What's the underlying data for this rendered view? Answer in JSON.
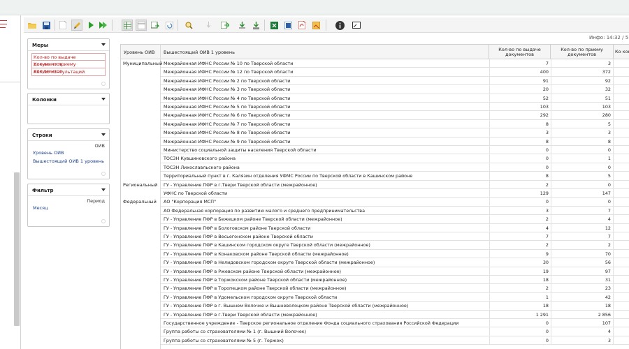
{
  "info": {
    "label": "Инфо:",
    "time": "14:32",
    "rest": "/ 5 :"
  },
  "panels": {
    "measures": {
      "title": "Меры",
      "items": [
        "Кол-во по выдаче документов",
        "Кол-во по приему документов",
        "Кол-во консультаций"
      ]
    },
    "columns": {
      "title": "Колонки"
    },
    "rows": {
      "title": "Строки",
      "sub": "ОИВ",
      "items": [
        "Уровень ОИВ",
        "Вышестоящий ОИВ 1 уровень"
      ]
    },
    "filter": {
      "title": "Фильтр",
      "sub": "Период",
      "items": [
        "Месяц"
      ]
    }
  },
  "table": {
    "headers": {
      "level": "Уровень ОИВ",
      "parent": "Вышестоящий ОИВ 1 уровень",
      "issue": "Кол-во по выдаче документов",
      "accept": "Кол-во по приему документов",
      "cons": "Ко конс"
    },
    "groups": [
      {
        "label": "Муниципальный",
        "startRow": 0
      },
      {
        "label": "Региональный",
        "startRow": 14
      },
      {
        "label": "Федеральный",
        "startRow": 16
      }
    ],
    "rows": [
      {
        "name": "Межрайонная ИФНС России № 10 по Тверской области",
        "issue": "7",
        "accept": "3"
      },
      {
        "name": "Межрайонная ИФНС России № 12 по Тверской области",
        "issue": "400",
        "accept": "372"
      },
      {
        "name": "Межрайонная ИФНС России № 2 по Тверской области",
        "issue": "91",
        "accept": "92"
      },
      {
        "name": "Межрайонная ИФНС России № 3 по Тверской области",
        "issue": "20",
        "accept": "32"
      },
      {
        "name": "Межрайонная ИФНС России № 4 по Тверской области",
        "issue": "52",
        "accept": "51"
      },
      {
        "name": "Межрайонная ИФНС России № 5 по Тверской области",
        "issue": "103",
        "accept": "103"
      },
      {
        "name": "Межрайонная ИФНС России № 6 по Тверской области",
        "issue": "292",
        "accept": "280"
      },
      {
        "name": "Межрайонная ИФНС России № 7 по Тверской области",
        "issue": "8",
        "accept": "5"
      },
      {
        "name": "Межрайонная ИФНС России № 8 по Тверской области",
        "issue": "3",
        "accept": "3"
      },
      {
        "name": "Межрайонная ИФНС России № 9 по Тверской области",
        "issue": "8",
        "accept": "8"
      },
      {
        "name": "Министерство социальной защиты населения Тверской области",
        "issue": "0",
        "accept": "0"
      },
      {
        "name": "ТОСЗН Кувшиновского района",
        "issue": "0",
        "accept": "1"
      },
      {
        "name": "ТОСЗН Лихославльского района",
        "issue": "0",
        "accept": "0"
      },
      {
        "name": "Территориальный пункт в г. Калязин отделения УФМС России по Тверской области в Кашинском районе",
        "issue": "8",
        "accept": "5"
      },
      {
        "name": "ГУ - Управление ПФР в г.Твери Тверской области (межрайонное)",
        "issue": "2",
        "accept": "0"
      },
      {
        "name": "УФНС по Тверской области",
        "issue": "129",
        "accept": "147"
      },
      {
        "name": "АО \"Корпорация МСП\"",
        "issue": "0",
        "accept": "0"
      },
      {
        "name": "АО Федеральная корпорация по развитию малого и среднего предпринимательства",
        "issue": "3",
        "accept": "7"
      },
      {
        "name": "ГУ - Управление ПФР в Бежецком районе Тверской области (межрайонное)",
        "issue": "2",
        "accept": "4"
      },
      {
        "name": "ГУ - Управление ПФР в Бологовском районе Тверской области",
        "issue": "4",
        "accept": "12"
      },
      {
        "name": "ГУ - Управление ПФР в Весьегонском районе Тверской области",
        "issue": "7",
        "accept": "7"
      },
      {
        "name": "ГУ - Управление ПФР в Кашинском городском округе Тверской области (межрайонное)",
        "issue": "2",
        "accept": "2"
      },
      {
        "name": "ГУ - Управление ПФР в Конаковском районе Тверской области (межрайонное)",
        "issue": "9",
        "accept": "70"
      },
      {
        "name": "ГУ - Управление ПФР в Нелидовском городском округе Тверской области (межрайонное)",
        "issue": "30",
        "accept": "56"
      },
      {
        "name": "ГУ - Управление ПФР в Ржевском районе Тверской области (межрайонное)",
        "issue": "19",
        "accept": "97"
      },
      {
        "name": "ГУ - Управление ПФР в Торжокском районе Тверской области (межрайонное)",
        "issue": "18",
        "accept": "31"
      },
      {
        "name": "ГУ - Управление ПФР в Торопецком районе Тверской области (межрайонное)",
        "issue": "2",
        "accept": "23"
      },
      {
        "name": "ГУ - Управление ПФР в Удомельском городском округе Тверской области",
        "issue": "1",
        "accept": "42"
      },
      {
        "name": "ГУ - Управление ПФР в г. Вышнем Волочке и Вышневолоцком районе Тверской области (межрайонное)",
        "issue": "18",
        "accept": "18"
      },
      {
        "name": "ГУ - Управление ПФР в г.Твери Тверской области (межрайонное)",
        "issue": "1 291",
        "accept": "2 856"
      },
      {
        "name": "Государственное учреждение - Тверское региональное отделение Фонда социального страхования Российской Федерации",
        "issue": "0",
        "accept": "107"
      },
      {
        "name": "Группа работы со страхователями № 1 (г. Вышний Волочек)",
        "issue": "0",
        "accept": "4"
      },
      {
        "name": "Группа работы со страхователями № 5 (г. Торжок)",
        "issue": "0",
        "accept": "3"
      }
    ]
  }
}
